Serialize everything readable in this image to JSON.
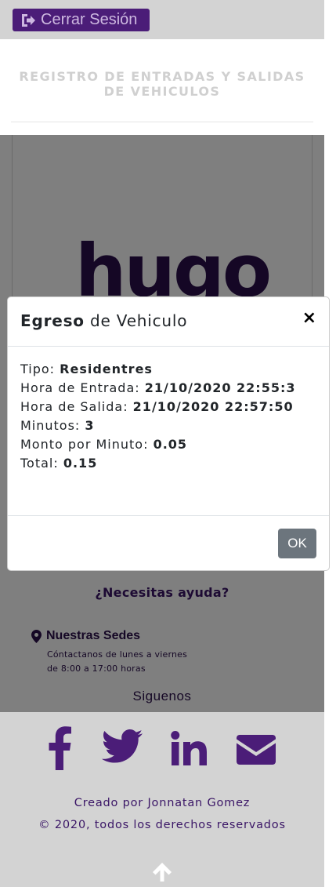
{
  "header": {
    "logout_label": "Cerrar Sesión",
    "page_title_line1": "REGISTRO DE ENTRADAS Y SALIDAS",
    "page_title_line2": "DE VEHICULOS"
  },
  "card": {
    "logo_text": "hugo"
  },
  "modal": {
    "title_bold": "Egreso",
    "title_rest": " de Vehiculo",
    "close_symbol": "×",
    "fields": [
      {
        "label": "Tipo: ",
        "value": "Residentres"
      },
      {
        "label": "Hora de Entrada: ",
        "value": "21/10/2020 22:55:3"
      },
      {
        "label": "Hora de Salida: ",
        "value": "21/10/2020 22:57:50"
      },
      {
        "label": "Minutos: ",
        "value": "3"
      },
      {
        "label": "Monto por Minuto: ",
        "value": "0.05"
      },
      {
        "label": "Total: ",
        "value": "0.15"
      }
    ],
    "ok_label": "OK"
  },
  "help": {
    "title": "¿Necesitas ayuda?",
    "sedes_title": "Nuestras Sedes",
    "sedes_line1": "Cóntactanos de lunes a viernes",
    "sedes_line2": "de 8:00 a 17:00 horas",
    "follow": "Siguenos"
  },
  "footer": {
    "social_icons": [
      "facebook-icon",
      "twitter-icon",
      "linkedin-icon",
      "envelope-icon"
    ],
    "credit_line1": "Creado por Jonnatan Gomez",
    "credit_line2": "© 2020, todos los derechos reservados"
  },
  "colors": {
    "brand_purple": "#4b1d78",
    "dark_purple": "#2a0f4a",
    "topbar_bg": "#d3d3d3",
    "ok_button": "#6c757d"
  }
}
